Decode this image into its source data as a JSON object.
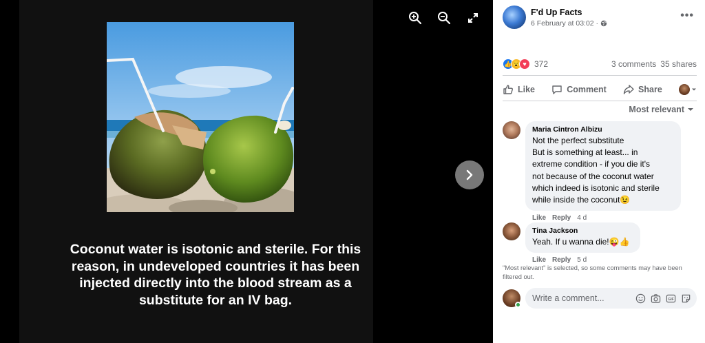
{
  "post": {
    "caption": "Coconut water is isotonic and sterile. For this reason, in undeveloped countries it has been injected directly into the blood stream as a substitute for an IV bag."
  },
  "viewer": {
    "icons": [
      "zoom-in-icon",
      "zoom-out-icon",
      "fullscreen-icon",
      "chevron-right-icon"
    ]
  },
  "page": {
    "name": "F'd Up Facts",
    "date": "6 February at 03:02 ·"
  },
  "stats": {
    "reaction_count": "372",
    "comments": "3 comments",
    "shares": "35 shares"
  },
  "actions": {
    "like": "Like",
    "comment": "Comment",
    "share": "Share"
  },
  "sort_label": "Most relevant",
  "comments": [
    {
      "name": "Maria Cintron Albizu",
      "text": "Not the perfect substitute\nBut is something at least... in\nextreme condition - if you die it's\nnot because of the coconut water\nwhich indeed is isotonic and sterile\nwhile inside the coconut😉",
      "like": "Like",
      "reply": "Reply",
      "time": "4 d"
    },
    {
      "name": "Tina Jackson",
      "text": "Yeah. If u wanna die!😜👍",
      "like": "Like",
      "reply": "Reply",
      "time": "5 d"
    }
  ],
  "filter_note": "\"Most relevant\" is selected, so some comments may have been filtered out.",
  "write_comment": {
    "placeholder": "Write a comment..."
  },
  "colors": {
    "accent": "#1877f2",
    "wow": "#f7b928",
    "love": "#f33e58",
    "online": "#31a24c"
  }
}
